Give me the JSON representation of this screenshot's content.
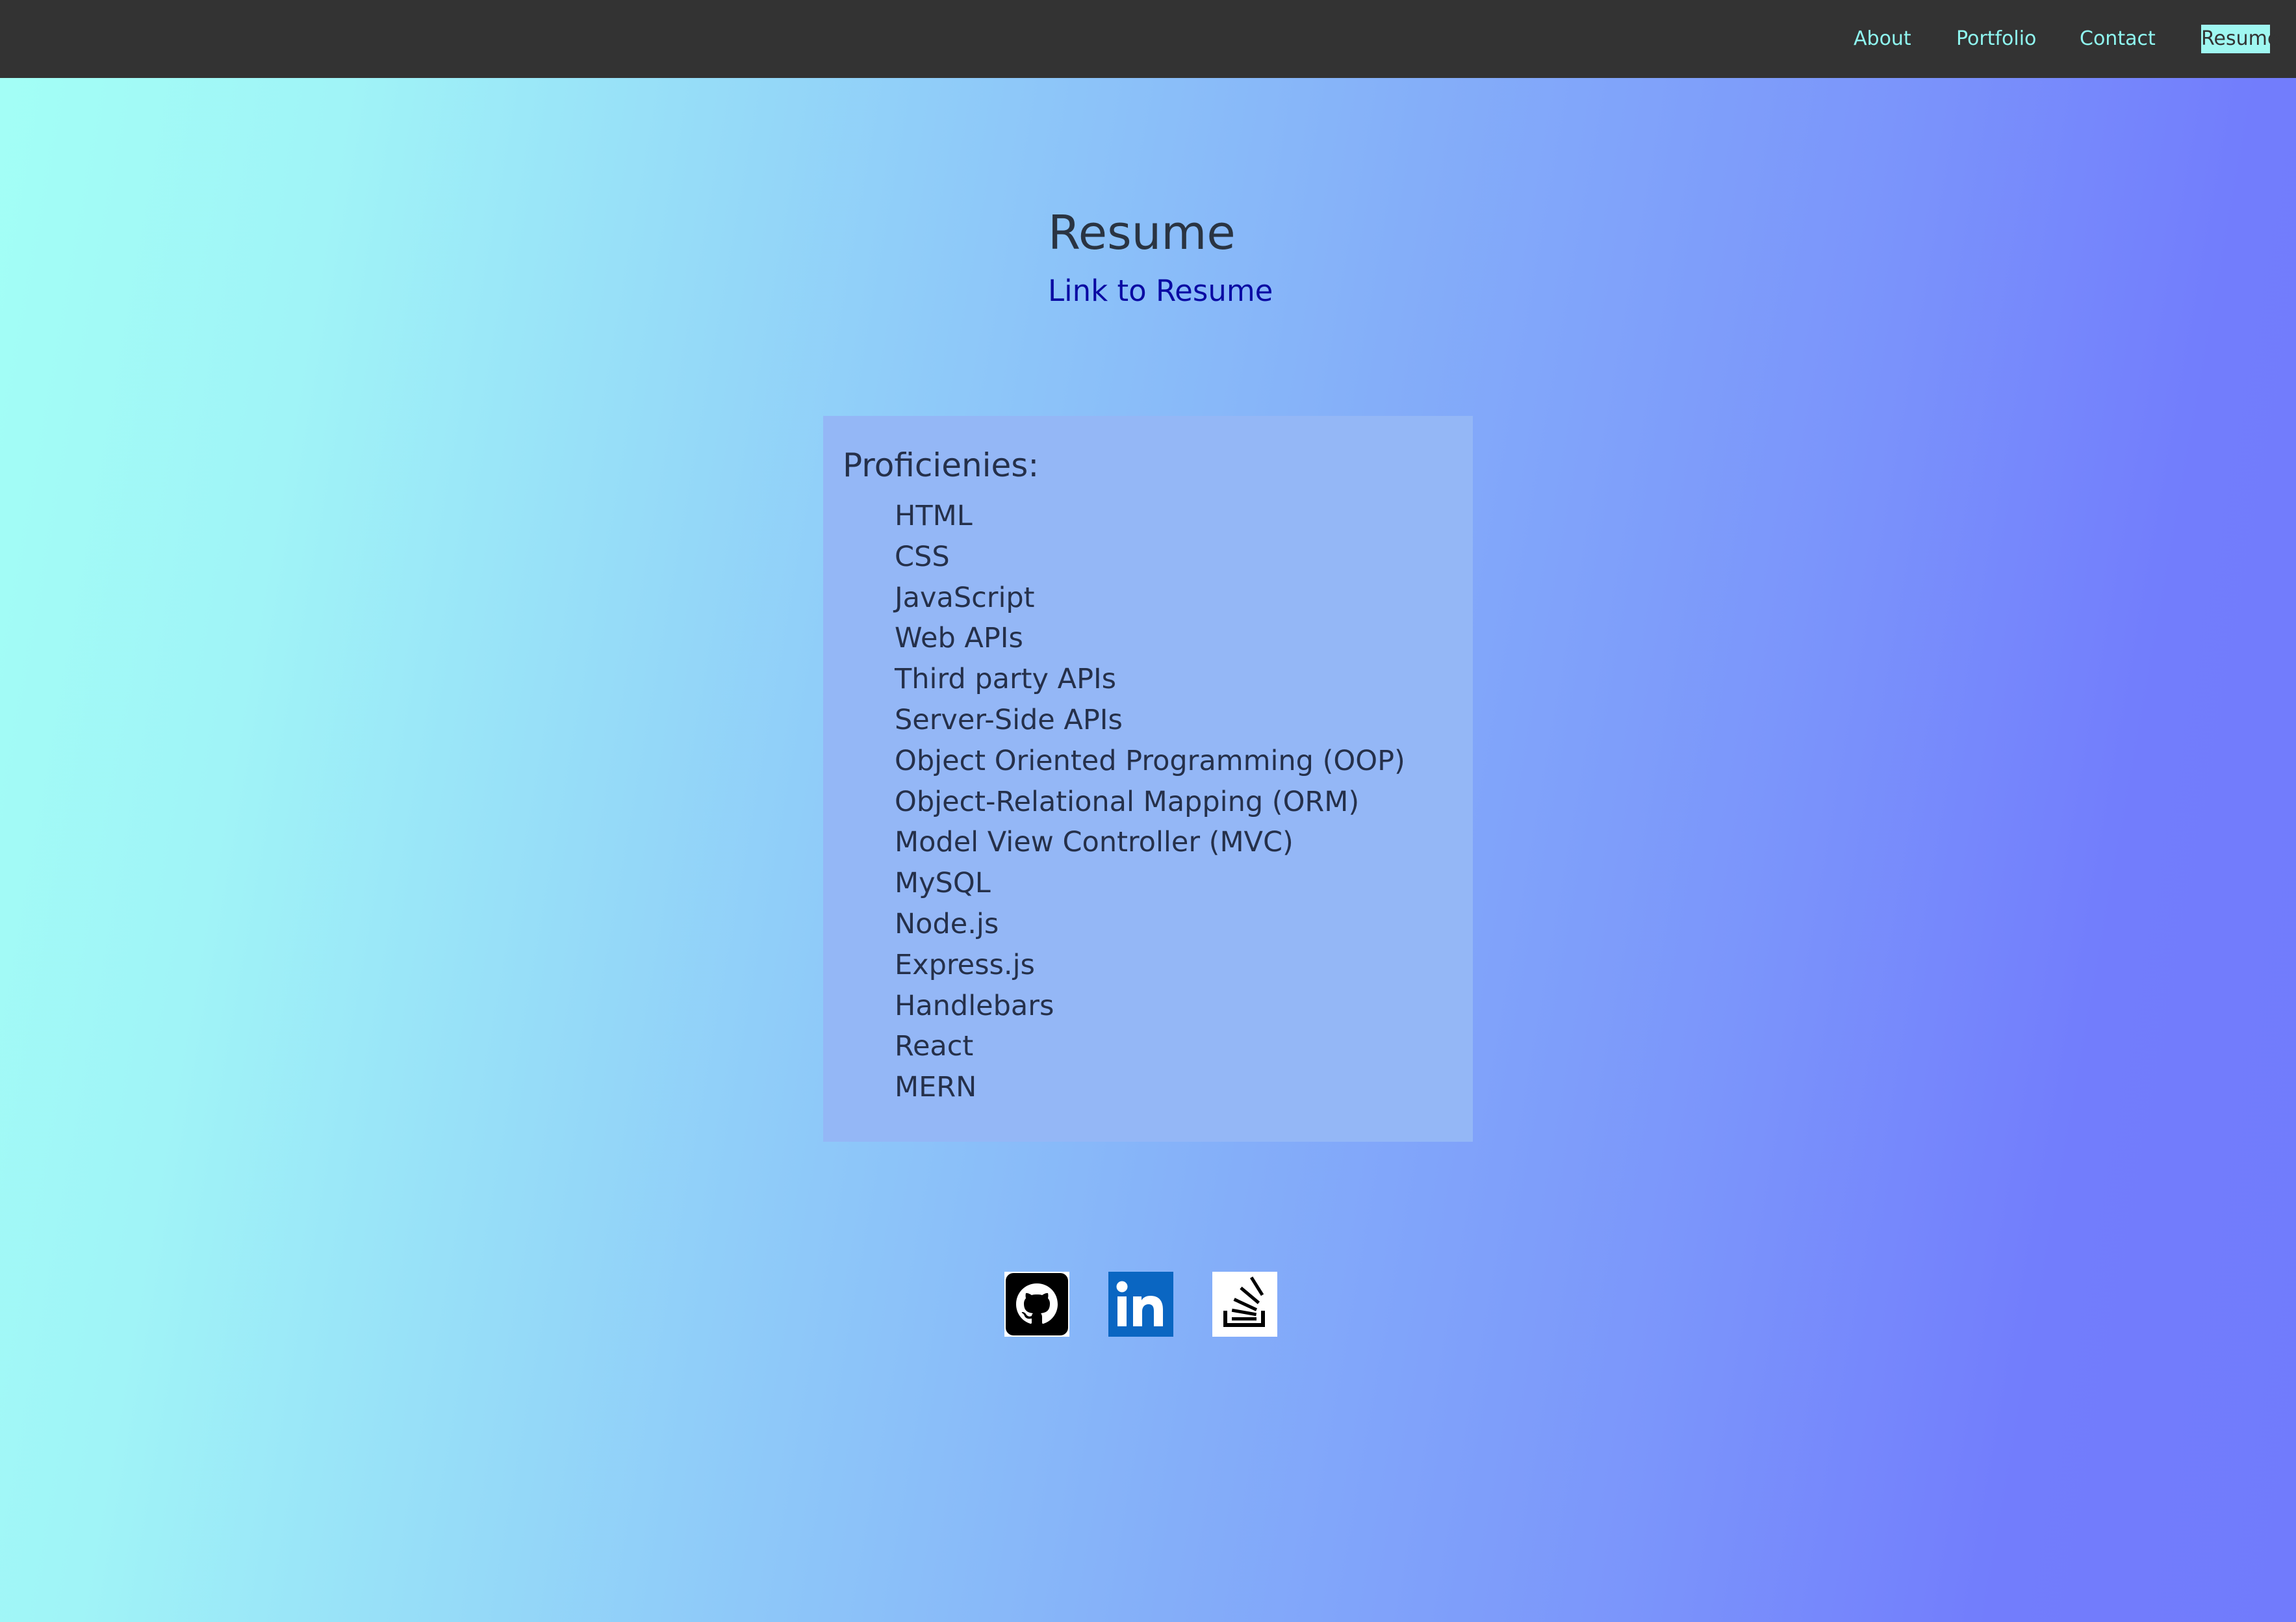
{
  "nav": {
    "items": [
      {
        "label": "About"
      },
      {
        "label": "Portfolio"
      },
      {
        "label": "Contact"
      },
      {
        "label": "Resume",
        "active": true
      }
    ]
  },
  "main": {
    "title": "Resume",
    "link_text": "Link to Resume"
  },
  "proficiencies": {
    "title": "Proficienies:",
    "items": [
      "HTML",
      "CSS",
      "JavaScript",
      "Web APIs",
      "Third party APIs",
      "Server-Side APIs",
      "Object Oriented Programming (OOP)",
      "Object-Relational Mapping (ORM)",
      "Model View Controller (MVC)",
      "MySQL",
      "Node.js",
      "Express.js",
      "Handlebars",
      "React",
      "MERN"
    ]
  },
  "footer": {
    "icons": [
      "github-icon",
      "linkedin-icon",
      "stackoverflow-icon"
    ]
  },
  "colors": {
    "navbar": "#333333",
    "nav_text": "#8ff6f0",
    "active_nav_bg": "#9ff7f1",
    "gradient_start": "#a3fff6",
    "gradient_end": "#717bfc",
    "card_bg": "#94b7f6",
    "link": "#0a0aa3",
    "linkedin_blue": "#0a66c2"
  }
}
